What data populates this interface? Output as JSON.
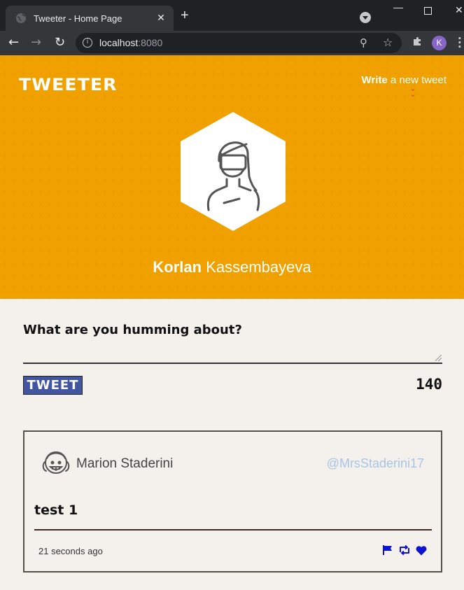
{
  "browser": {
    "tab_title": "Tweeter - Home Page",
    "tab_close": "✕",
    "new_tab": "+",
    "url_host": "localhost",
    "url_port": ":8080",
    "profile_initial": "K"
  },
  "header": {
    "brand": "TWEETER",
    "write_bold": "Write",
    "write_rest": " a new tweet"
  },
  "profile": {
    "first_name": "Korlan",
    "last_name": " Kassembayeva"
  },
  "compose": {
    "label": "What are you humming about?",
    "input_value": "",
    "button_label": "TWEET",
    "counter": "140"
  },
  "tweets": [
    {
      "author": "Marion Staderini",
      "handle": "@MrsStaderini17",
      "content": "test 1",
      "time": "21 seconds ago",
      "actions": [
        "flag-icon",
        "retweet-icon",
        "heart-icon"
      ]
    }
  ],
  "colors": {
    "header_bg": "#f0a100",
    "page_bg": "#f4f1ec",
    "button_bg": "#4255a0",
    "handle": "#a8c4e6",
    "action_icons": "#0c12d6"
  }
}
